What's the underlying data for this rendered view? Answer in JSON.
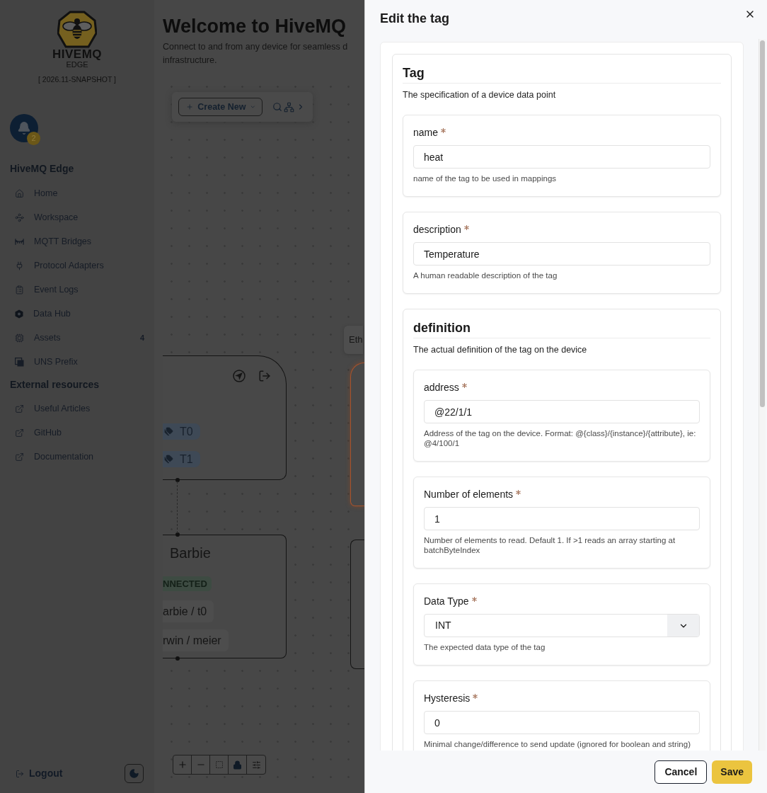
{
  "sidebar": {
    "logo": {
      "wordmark": "HIVEMQ",
      "edition": "EDGE"
    },
    "version": "[ 2026.11-SNAPSHOT ]",
    "notifications": {
      "count": "2"
    },
    "sections": [
      {
        "title": "HiveMQ Edge",
        "kind": "nav",
        "items": [
          {
            "label": "Home"
          },
          {
            "label": "Workspace"
          },
          {
            "label": "MQTT Bridges"
          },
          {
            "label": "Protocol Adapters"
          },
          {
            "label": "Event Logs"
          },
          {
            "label": "Data Hub"
          },
          {
            "label": "Assets",
            "badge": "4"
          },
          {
            "label": "UNS Prefix"
          }
        ]
      },
      {
        "title": "External resources",
        "kind": "external",
        "items": [
          {
            "label": "Useful Articles"
          },
          {
            "label": "GitHub"
          },
          {
            "label": "Documentation"
          }
        ]
      }
    ],
    "logout": "Logout"
  },
  "canvas": {
    "title": "Welcome to HiveMQ",
    "subtitle_lines": [
      "Connect to and from any device for seamless d",
      "infrastructure."
    ],
    "toolbar": {
      "create_button": "Create New"
    },
    "nodes": [
      {
        "kind": "adapter",
        "selected": false,
        "tags": [
          "T0",
          "T1"
        ]
      },
      {
        "kind": "bridge",
        "selected": false,
        "title": "Barbie",
        "status": "NNECTED",
        "topics": [
          "arbie / t0",
          "rwin / meier"
        ]
      },
      {
        "kind": "clipped",
        "selected": true
      },
      {
        "kind": "clipped",
        "selected": false
      }
    ],
    "tooltip": "Eth"
  },
  "drawer": {
    "title": "Edit the tag",
    "form": {
      "title": "Tag",
      "description": "The specification of a device data point",
      "items": [
        {
          "kind": "input",
          "label": "name",
          "required": true,
          "value": "heat",
          "helper": "name of the tag to be used in mappings"
        },
        {
          "kind": "input",
          "label": "description",
          "required": true,
          "value": "Temperature",
          "helper": "A human readable description of the tag"
        },
        {
          "kind": "group",
          "title": "definition",
          "description": "The actual definition of the tag on the device",
          "items": [
            {
              "kind": "input",
              "label": "address",
              "required": true,
              "value": "@22/1/1",
              "helper": "Address of the tag on the device. Format: @{class}/{instance}/{attribute}, ie: @4/100/1"
            },
            {
              "kind": "input",
              "label": "Number of elements",
              "required": true,
              "value": "1",
              "helper": "Number of elements to read. Default 1. If >1 reads an array starting at batchByteIndex"
            },
            {
              "kind": "select",
              "label": "Data Type",
              "required": true,
              "value": "INT",
              "helper": "The expected data type of the tag"
            },
            {
              "kind": "input",
              "label": "Hysteresis",
              "required": true,
              "value": "0",
              "helper": "Minimal change/difference to send update (ignored for boolean and string)"
            }
          ]
        }
      ]
    },
    "buttons": [
      {
        "label": "Cancel",
        "kind": "secondary"
      },
      {
        "label": "Save",
        "kind": "primary"
      }
    ]
  }
}
